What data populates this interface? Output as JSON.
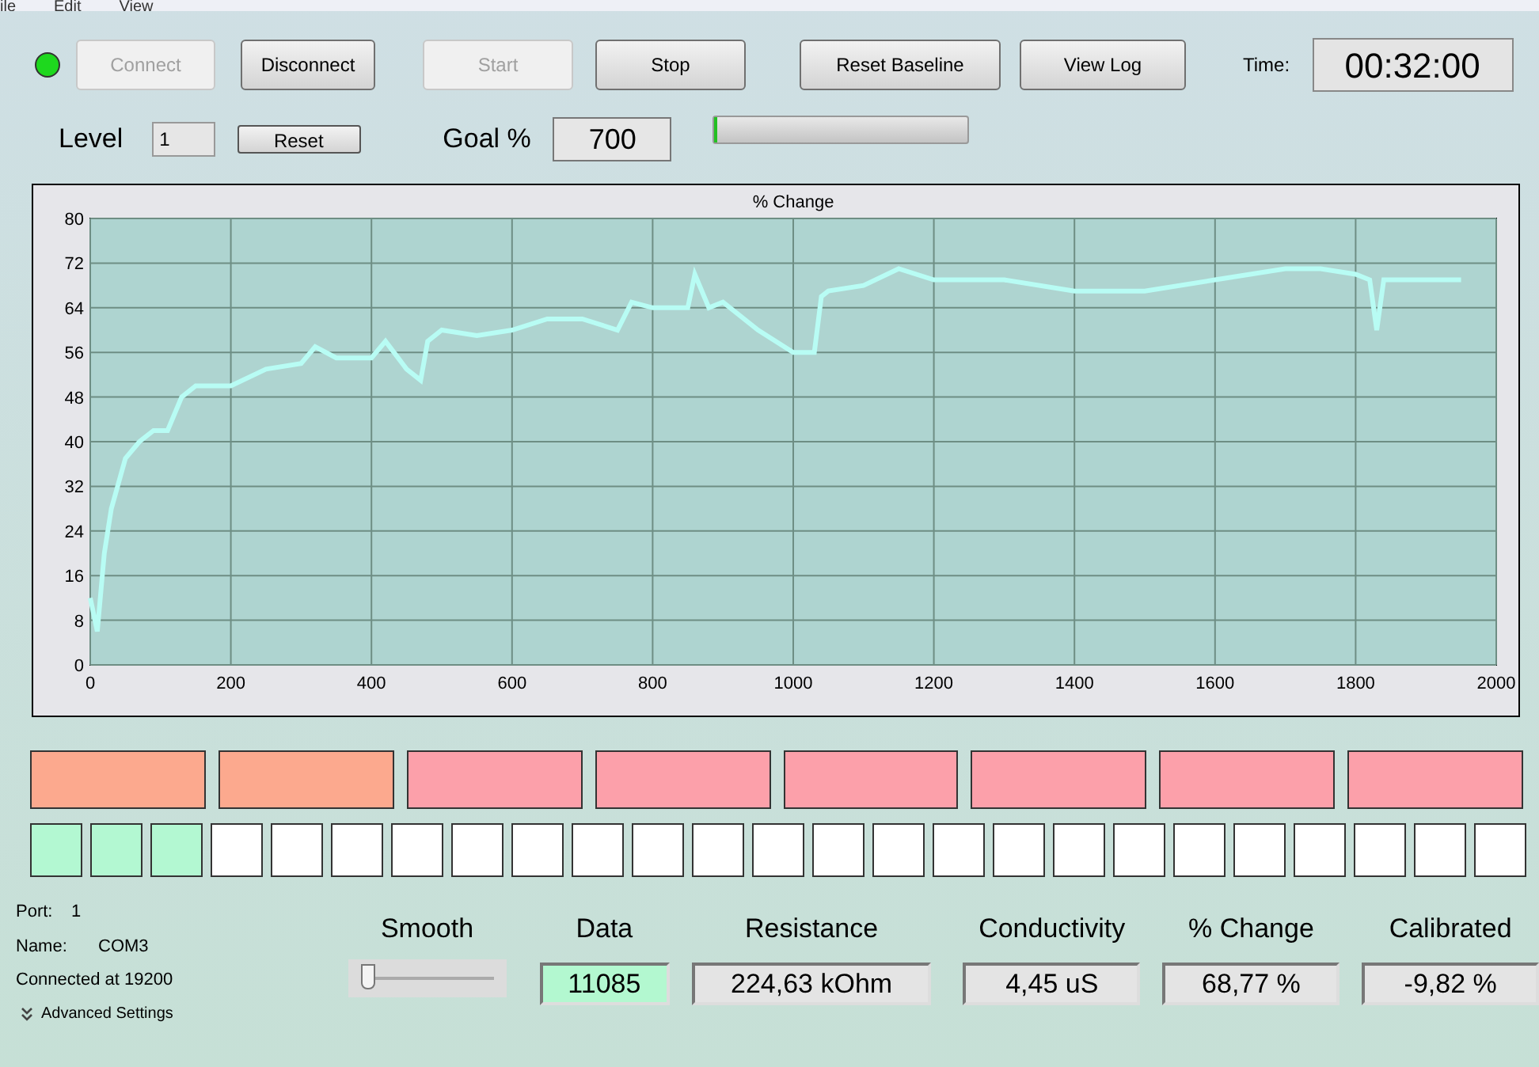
{
  "menu": [
    "ile",
    "Edit",
    "View"
  ],
  "status_led": {
    "on": true
  },
  "buttons": [
    {
      "label": "Connect",
      "disabled": true
    },
    {
      "label": "Disconnect",
      "disabled": false
    },
    {
      "label": "Start",
      "disabled": true
    },
    {
      "label": "Stop",
      "disabled": false
    },
    {
      "label": "Reset Baseline",
      "disabled": false
    },
    {
      "label": "View Log",
      "disabled": false
    }
  ],
  "time": {
    "label": "Time:",
    "value": "00:32:00"
  },
  "level": {
    "label": "Level",
    "value": "1",
    "reset": "Reset"
  },
  "goal": {
    "label": "Goal %",
    "value": "700",
    "progress": {
      "level": 0.01
    }
  },
  "chart": {
    "chart_data": {
      "type": "line",
      "title": "% Change",
      "xlim": [
        0,
        2000
      ],
      "ylim": [
        0,
        80
      ],
      "xticks": [
        0,
        200,
        400,
        600,
        800,
        1000,
        1200,
        1400,
        1600,
        1800,
        2000
      ],
      "yticks": [
        0,
        8,
        16,
        24,
        32,
        40,
        48,
        56,
        64,
        72,
        80
      ],
      "x": [
        0,
        10,
        20,
        30,
        50,
        70,
        90,
        110,
        130,
        150,
        200,
        250,
        300,
        320,
        350,
        400,
        420,
        450,
        470,
        480,
        500,
        550,
        600,
        650,
        700,
        750,
        770,
        800,
        850,
        860,
        880,
        900,
        950,
        1000,
        1030,
        1040,
        1050,
        1100,
        1150,
        1200,
        1300,
        1400,
        1500,
        1600,
        1700,
        1750,
        1800,
        1820,
        1830,
        1840,
        1900,
        1950
      ],
      "grid": true,
      "series": [
        {
          "color": "#b8fcf4",
          "values": [
            12,
            6,
            20,
            28,
            37,
            40,
            42,
            42,
            48,
            50,
            50,
            53,
            54,
            57,
            55,
            55,
            58,
            53,
            51,
            58,
            60,
            59,
            60,
            62,
            62,
            60,
            65,
            64,
            64,
            70,
            64,
            65,
            60,
            56,
            56,
            66,
            67,
            68,
            71,
            69,
            69,
            67,
            67,
            69,
            71,
            71,
            70,
            69,
            60,
            69,
            69,
            69
          ]
        }
      ]
    }
  },
  "tiles": [
    {
      "color": "#fca98e"
    },
    {
      "color": "#fca98e"
    },
    {
      "color": "#fca0aa"
    },
    {
      "color": "#fca0aa"
    },
    {
      "color": "#fca0aa"
    },
    {
      "color": "#fca0aa"
    },
    {
      "color": "#fca0aa"
    },
    {
      "color": "#fca0aa"
    }
  ],
  "cells": [
    {
      "lit": true
    },
    {
      "lit": true
    },
    {
      "lit": true
    },
    {
      "lit": false
    },
    {
      "lit": false
    },
    {
      "lit": false
    },
    {
      "lit": false
    },
    {
      "lit": false
    },
    {
      "lit": false
    },
    {
      "lit": false
    },
    {
      "lit": false
    },
    {
      "lit": false
    },
    {
      "lit": false
    },
    {
      "lit": false
    },
    {
      "lit": false
    },
    {
      "lit": false
    },
    {
      "lit": false
    },
    {
      "lit": false
    },
    {
      "lit": false
    },
    {
      "lit": false
    },
    {
      "lit": false
    },
    {
      "lit": false
    },
    {
      "lit": false
    },
    {
      "lit": false
    },
    {
      "lit": false
    }
  ],
  "port_info": [
    {
      "label": "Port:",
      "value": "1"
    },
    {
      "label": "Name:",
      "value": "COM3"
    }
  ],
  "connection": "Connected at 19200",
  "advanced_settings": "Advanced Settings",
  "smooth": {
    "label": "Smooth",
    "level": 0.05
  },
  "readings": [
    {
      "label": "Data",
      "value": "11085",
      "highlighted": true
    },
    {
      "label": "Resistance",
      "value": "224,63 kOhm",
      "highlighted": false
    },
    {
      "label": "Conductivity",
      "value": "4,45 uS",
      "highlighted": false
    },
    {
      "label": "% Change",
      "value": "68,77 %",
      "highlighted": false
    },
    {
      "label": "Calibrated",
      "value": "-9,82 %",
      "highlighted": false
    }
  ]
}
